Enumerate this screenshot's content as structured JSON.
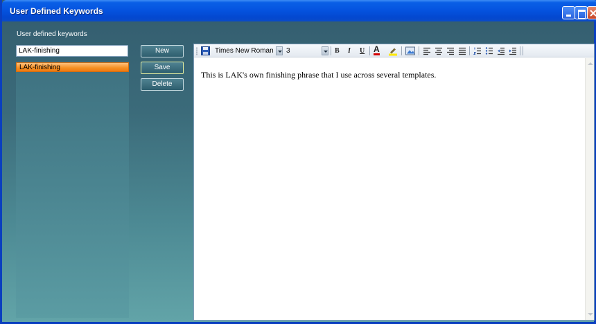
{
  "window": {
    "title": "User Defined Keywords",
    "colors": {
      "titlebar": "#0554e0",
      "panel": "#3b6b7a",
      "selected_item": "#f58f22"
    }
  },
  "keywords": {
    "section_label": "User defined keywords",
    "input_value": "LAK-finishing",
    "items": [
      {
        "label": "LAK-finishing",
        "selected": true
      }
    ]
  },
  "buttons": {
    "new": "New",
    "save": "Save",
    "delete": "Delete"
  },
  "toolbar": {
    "font_name": "Times New Roman",
    "font_size": "3",
    "icons": [
      "save-icon",
      "bold-icon",
      "italic-icon",
      "underline-icon",
      "font-color-icon",
      "highlight-icon",
      "insert-image-icon",
      "align-left-icon",
      "align-center-icon",
      "align-right-icon",
      "justify-icon",
      "numbered-list-icon",
      "bullet-list-icon",
      "outdent-icon",
      "indent-icon"
    ],
    "bold": "B",
    "italic": "I",
    "underline": "U",
    "font_color": "A"
  },
  "editor": {
    "content": "This is LAK's own finishing phrase that I use across several templates."
  }
}
